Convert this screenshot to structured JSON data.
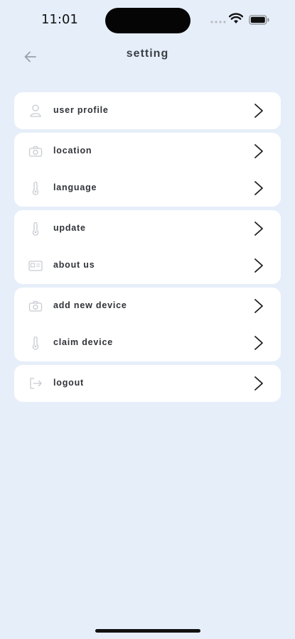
{
  "status": {
    "time": "11:01"
  },
  "header": {
    "title": "setting",
    "back_icon": "arrow-left-icon"
  },
  "groups": [
    [
      {
        "label": "user profile",
        "icon": "user-icon"
      }
    ],
    [
      {
        "label": "location",
        "icon": "camera-icon"
      },
      {
        "label": "language",
        "icon": "thermometer-icon"
      }
    ],
    [
      {
        "label": "update",
        "icon": "thermometer-icon"
      },
      {
        "label": "about us",
        "icon": "id-card-icon"
      }
    ],
    [
      {
        "label": "add new device",
        "icon": "camera-icon"
      },
      {
        "label": "claim device",
        "icon": "thermometer-icon"
      }
    ],
    [
      {
        "label": "logout",
        "icon": "logout-icon"
      }
    ]
  ],
  "colors": {
    "background": "#e6eef9",
    "card": "#ffffff",
    "icon_gray": "#c7cbd1",
    "text": "#2f3237"
  }
}
